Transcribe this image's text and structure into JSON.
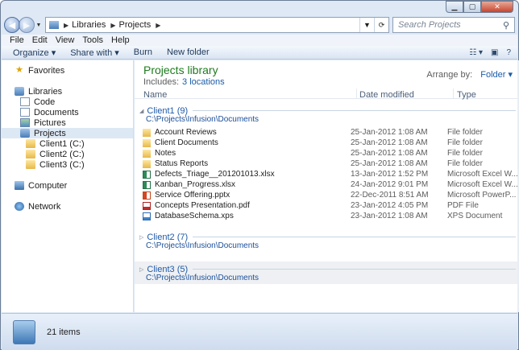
{
  "window": {
    "address": [
      "Libraries",
      "Projects"
    ],
    "search_placeholder": "Search Projects"
  },
  "menu": [
    "File",
    "Edit",
    "View",
    "Tools",
    "Help"
  ],
  "toolbar": {
    "commands": [
      "Organize ▾",
      "Share with ▾",
      "Burn",
      "New folder"
    ]
  },
  "nav": {
    "favorites": "Favorites",
    "libraries": "Libraries",
    "library_items": [
      "Code",
      "Documents",
      "Pictures",
      "Projects"
    ],
    "project_items": [
      "Client1 (C:)",
      "Client2 (C:)",
      "Client3 (C:)"
    ],
    "computer": "Computer",
    "network": "Network"
  },
  "library": {
    "title": "Projects library",
    "includes_label": "Includes:",
    "includes_link": "3 locations",
    "arrange_label": "Arrange by:",
    "arrange_value": "Folder ▾"
  },
  "columns": [
    "Name",
    "Date modified",
    "Type"
  ],
  "groups": [
    {
      "name": "Client1 (9)",
      "path": "C:\\Projects\\Infusion\\Documents",
      "expanded": true,
      "files": [
        {
          "name": "Account Reviews",
          "date": "25-Jan-2012 1:08 AM",
          "type": "File folder",
          "icon": "folder"
        },
        {
          "name": "Client Documents",
          "date": "25-Jan-2012 1:08 AM",
          "type": "File folder",
          "icon": "folder"
        },
        {
          "name": "Notes",
          "date": "25-Jan-2012 1:08 AM",
          "type": "File folder",
          "icon": "folder"
        },
        {
          "name": "Status Reports",
          "date": "25-Jan-2012 1:08 AM",
          "type": "File folder",
          "icon": "folder"
        },
        {
          "name": "Defects_Triage__201201013.xlsx",
          "date": "13-Jan-2012 1:52 PM",
          "type": "Microsoft Excel W...",
          "icon": "xlsx"
        },
        {
          "name": "Kanban_Progress.xlsx",
          "date": "24-Jan-2012 9:01 PM",
          "type": "Microsoft Excel W...",
          "icon": "xlsx"
        },
        {
          "name": "Service Offering.pptx",
          "date": "22-Dec-2011 8:51 AM",
          "type": "Microsoft PowerP...",
          "icon": "pptx"
        },
        {
          "name": "Concepts Presentation.pdf",
          "date": "23-Jan-2012 4:05 PM",
          "type": "PDF File",
          "icon": "pdf"
        },
        {
          "name": "DatabaseSchema.xps",
          "date": "23-Jan-2012 1:08 AM",
          "type": "XPS Document",
          "icon": "xps"
        }
      ]
    },
    {
      "name": "Client2 (7)",
      "path": "C:\\Projects\\Infusion\\Documents",
      "expanded": false,
      "files": []
    },
    {
      "name": "Client3 (5)",
      "path": "C:\\Projects\\Infusion\\Documents",
      "expanded": false,
      "files": []
    }
  ],
  "status": {
    "count": "21 items"
  }
}
